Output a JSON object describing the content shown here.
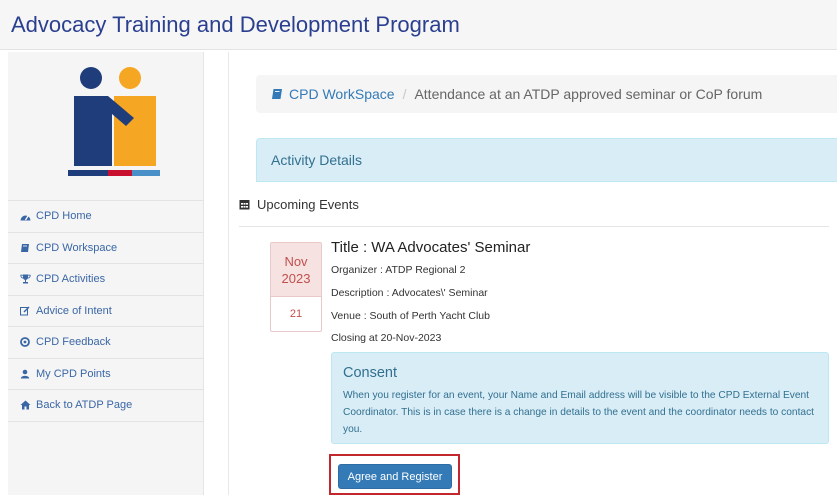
{
  "app": {
    "title": "Advocacy Training and Development Program"
  },
  "sidebar": {
    "items": [
      {
        "label": "CPD Home",
        "icon": "dashboard-icon"
      },
      {
        "label": "CPD Workspace",
        "icon": "book-icon"
      },
      {
        "label": "CPD Activities",
        "icon": "trophy-icon"
      },
      {
        "label": "Advice of Intent",
        "icon": "edit-icon"
      },
      {
        "label": "CPD Feedback",
        "icon": "lifebuoy-icon"
      },
      {
        "label": "My CPD Points",
        "icon": "user-icon"
      },
      {
        "label": "Back to ATDP Page",
        "icon": "home-icon"
      }
    ]
  },
  "breadcrumb": {
    "link": "CPD WorkSpace",
    "separator": "/",
    "current": "Attendance at an ATDP approved seminar or CoP forum"
  },
  "activity": {
    "heading": "Activity Details"
  },
  "events": {
    "heading": "Upcoming Events",
    "items": [
      {
        "month": "Nov",
        "year": "2023",
        "day": "21",
        "title": "Title : WA Advocates' Seminar",
        "organizer": "Organizer : ATDP Regional 2",
        "description": "Description : Advocates\\' Seminar",
        "venue": "Venue : South of Perth Yacht Club",
        "closing": "Closing at 20-Nov-2023"
      }
    ]
  },
  "consent": {
    "title": "Consent",
    "text": "When you register for an event, your Name and Email address will be visible to the CPD External Event Coordinator. This is in case there is a change in details to the event and the coordinator needs to contact you."
  },
  "register": {
    "label": "Agree and Register"
  },
  "colors": {
    "title": "#2a3f8f",
    "link": "#337ab7",
    "info_bg": "#d9edf7",
    "info_text": "#31708f",
    "date_accent": "#c0504d",
    "highlight": "#c1272d",
    "logo_navy": "#1f3d7a",
    "logo_orange": "#f5a623",
    "logo_red": "#c8102e",
    "logo_blue": "#4a90c8"
  }
}
